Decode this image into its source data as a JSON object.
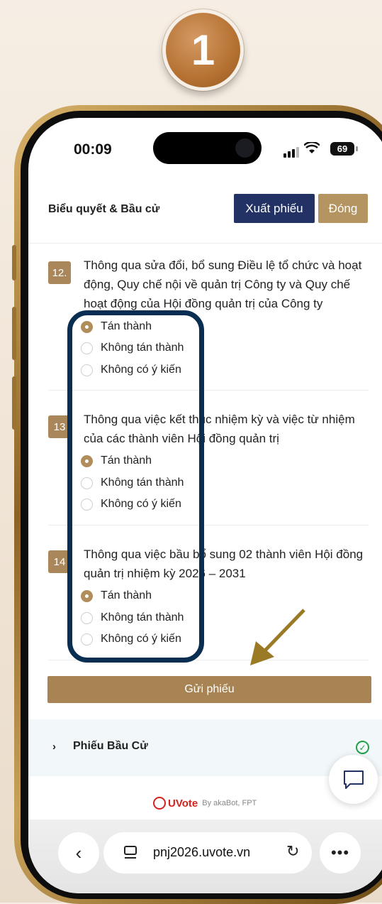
{
  "step_number": "1",
  "status": {
    "time": "00:09",
    "battery": "69"
  },
  "header": {
    "title": "Biểu quyết & Bầu cử",
    "export_label": "Xuất phiếu",
    "close_label": "Đóng"
  },
  "questions": [
    {
      "number": "12.",
      "text": "Thông qua sửa đổi, bổ sung Điều lệ tổ chức và hoạt động, Quy chế nội về quản trị Công ty và Quy chế hoạt động của Hội đồng quản trị của Công ty"
    },
    {
      "number": "13",
      "text": "Thông qua việc kết thúc nhiệm kỳ và việc từ nhiệm của các thành viên Hội đồng quản trị"
    },
    {
      "number": "14",
      "text": "Thông qua việc bầu bổ sung 02 thành viên Hội đồng quản trị nhiệm kỳ 2026 – 2031"
    }
  ],
  "options": {
    "agree": "Tán thành",
    "disagree": "Không tán thành",
    "no_opinion": "Không có ý kiến"
  },
  "selected_option": "Tán thành",
  "submit_label": "Gửi phiếu",
  "accordion": {
    "title": "Phiếu Bầu Cử"
  },
  "brand": {
    "name": "UVote",
    "by": "By akaBot, FPT"
  },
  "browser": {
    "url": "pnj2026.uvote.vn"
  },
  "colors": {
    "navy": "#223264",
    "gold": "#b49460",
    "annotation": "#0a2e52",
    "arrow": "#9a7a24"
  },
  "icons": [
    "signal-icon",
    "wifi-icon",
    "battery-icon",
    "radio-selected-icon",
    "radio-empty-icon",
    "chevron-right-icon",
    "check-circle-icon",
    "chat-icon",
    "back-icon",
    "tabs-icon",
    "reload-icon",
    "more-icon",
    "arrow-annotation-icon"
  ]
}
